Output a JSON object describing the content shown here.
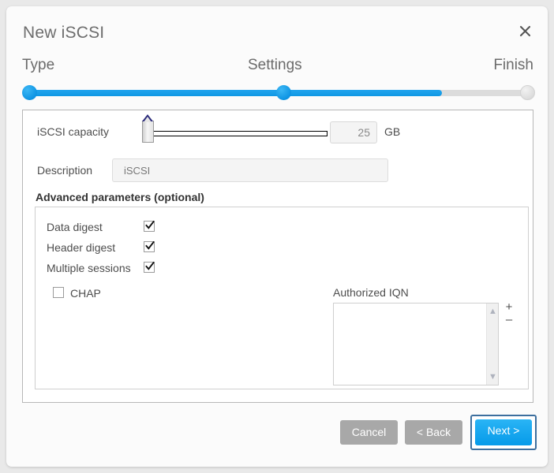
{
  "dialog": {
    "title": "New iSCSI",
    "close_icon": "close-icon"
  },
  "stepper": {
    "steps": [
      {
        "label": "Type",
        "state": "done"
      },
      {
        "label": "Settings",
        "state": "current"
      },
      {
        "label": "Finish",
        "state": "todo"
      }
    ],
    "progress_percent": 83,
    "accent_color": "#0f98e4",
    "inactive_color": "#dcdcdc"
  },
  "form": {
    "capacity": {
      "label": "iSCSI capacity",
      "value": "25",
      "unit": "GB",
      "slider_position_percent": 3
    },
    "description": {
      "label": "Description",
      "value": "iSCSI",
      "placeholder": "iSCSI"
    },
    "advanced": {
      "title": "Advanced parameters (optional)",
      "checkboxes": [
        {
          "label": "Data digest",
          "checked": true
        },
        {
          "label": "Header digest",
          "checked": true
        },
        {
          "label": "Multiple sessions",
          "checked": true
        }
      ],
      "chap": {
        "label": "CHAP",
        "checked": false
      },
      "iqn": {
        "label": "Authorized IQN",
        "items": [],
        "add_label": "+",
        "remove_label": "–",
        "scroll_up_icon": "chevron-up-icon",
        "scroll_down_icon": "chevron-down-icon"
      }
    }
  },
  "footer": {
    "cancel_label": "Cancel",
    "back_label": "< Back",
    "next_label": "Next >",
    "next_focused": true,
    "next_color": "#059ae9",
    "focus_ring_color": "#3d6f9e"
  }
}
